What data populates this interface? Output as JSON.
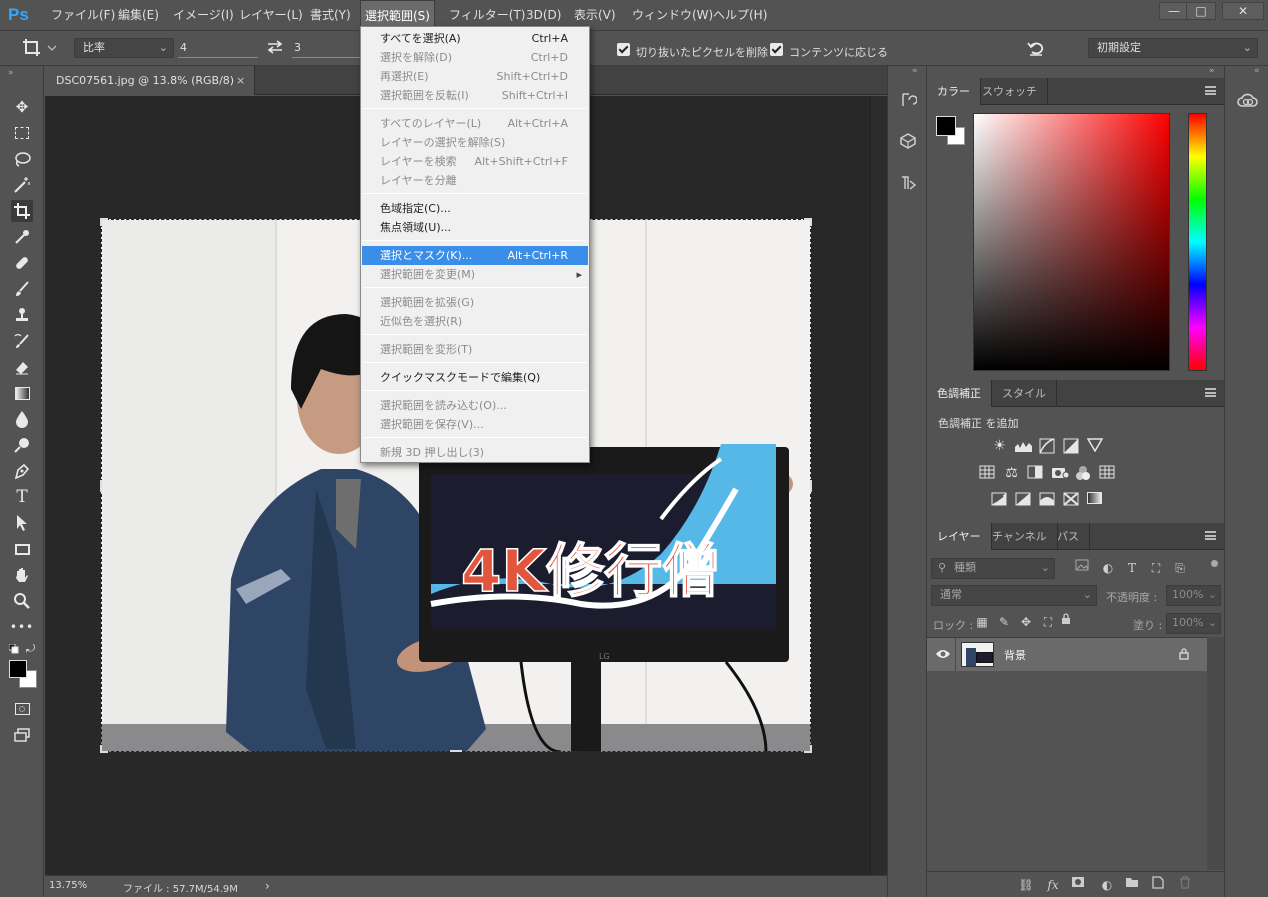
{
  "app": {
    "logo": "Ps"
  },
  "menubar": {
    "items": [
      "ファイル(F)",
      "編集(E)",
      "イメージ(I)",
      "レイヤー(L)",
      "書式(Y)",
      "選択範囲(S)",
      "フィルター(T)",
      "3D(D)",
      "表示(V)",
      "ウィンドウ(W)",
      "ヘルプ(H)"
    ],
    "active_index": 5,
    "window_controls": [
      "—",
      "□",
      "✕"
    ]
  },
  "options": {
    "ratio_label": "比率",
    "width_value": "4",
    "height_value": "3",
    "delete_cropped_label": "切り抜いたピクセルを削除",
    "content_aware_label": "コンテンツに応じる",
    "workspace_value": "初期設定"
  },
  "document": {
    "tab_title": "DSC07561.jpg @ 13.8% (RGB/8)",
    "tab_close": "×",
    "zoom": "13.75%",
    "file_info": "ファイル : 57.7M/54.9M",
    "status_arrow": "›"
  },
  "image": {
    "screen_text": "4K修行僧",
    "monitor_brand": "LG",
    "colors": {
      "wall": "#f2f1ef",
      "kimono": "#2e4566",
      "screen_bg": "#1b1d2e",
      "wave": "#56b8e6",
      "text": "#e2563d"
    }
  },
  "menu": {
    "items": [
      {
        "label": "すべてを選択(A)",
        "shortcut": "Ctrl+A",
        "disabled": false
      },
      {
        "label": "選択を解除(D)",
        "shortcut": "Ctrl+D",
        "disabled": true
      },
      {
        "label": "再選択(E)",
        "shortcut": "Shift+Ctrl+D",
        "disabled": true
      },
      {
        "label": "選択範囲を反転(I)",
        "shortcut": "Shift+Ctrl+I",
        "disabled": true
      },
      {
        "label": "すべてのレイヤー(L)",
        "shortcut": "Alt+Ctrl+A",
        "disabled": true
      },
      {
        "label": "レイヤーの選択を解除(S)",
        "shortcut": "",
        "disabled": true
      },
      {
        "label": "レイヤーを検索",
        "shortcut": "Alt+Shift+Ctrl+F",
        "disabled": true
      },
      {
        "label": "レイヤーを分離",
        "shortcut": "",
        "disabled": true
      },
      {
        "label": "色域指定(C)...",
        "shortcut": "",
        "disabled": false
      },
      {
        "label": "焦点領域(U)...",
        "shortcut": "",
        "disabled": false
      },
      {
        "label": "選択とマスク(K)...",
        "shortcut": "Alt+Ctrl+R",
        "disabled": false,
        "highlighted": true
      },
      {
        "label": "選択範囲を変更(M)",
        "shortcut": "",
        "disabled": true,
        "submenu": "▸"
      },
      {
        "label": "選択範囲を拡張(G)",
        "shortcut": "",
        "disabled": true
      },
      {
        "label": "近似色を選択(R)",
        "shortcut": "",
        "disabled": true
      },
      {
        "label": "選択範囲を変形(T)",
        "shortcut": "",
        "disabled": true
      },
      {
        "label": "クイックマスクモードで編集(Q)",
        "shortcut": "",
        "disabled": false
      },
      {
        "label": "選択範囲を読み込む(O)...",
        "shortcut": "",
        "disabled": true
      },
      {
        "label": "選択範囲を保存(V)...",
        "shortcut": "",
        "disabled": true
      },
      {
        "label": "新規 3D 押し出し(3)",
        "shortcut": "",
        "disabled": true
      }
    ]
  },
  "panels": {
    "color_tabs": [
      "カラー",
      "スウォッチ"
    ],
    "adjust_tabs": [
      "色調補正",
      "スタイル"
    ],
    "adjust_title": "色調補正 を追加",
    "layer_tabs": [
      "レイヤー",
      "チャンネル",
      "パス"
    ],
    "layer_filter_placeholder": "種類",
    "blend_mode": "通常",
    "opacity_label": "不透明度 :",
    "opacity_value": "100%",
    "lock_label": "ロック :",
    "fill_label": "塗り :",
    "fill_value": "100%",
    "layer_name": "背景"
  }
}
